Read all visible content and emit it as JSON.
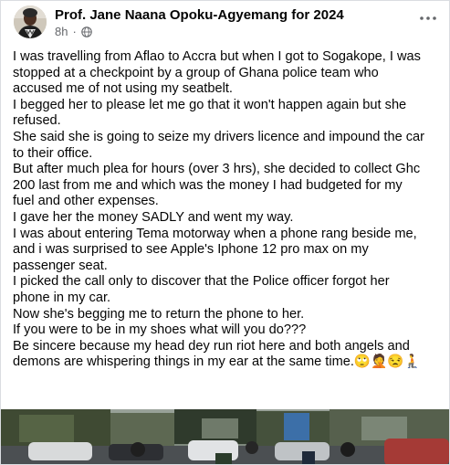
{
  "post": {
    "author": "Prof. Jane Naana Opoku-Agyemang for 2024",
    "time": "8h",
    "separator": "·",
    "privacy_icon": "globe-icon",
    "more_icon": "more-options-icon",
    "lines": [
      "I was travelling from Aflao to Accra but when I got to Sogakope, I was",
      "stopped at a checkpoint by a group of Ghana police team who",
      "accused me of not using my seatbelt.",
      "I begged her to please let me go that it won't happen again but she",
      "refused.",
      "She said she is going to seize my drivers licence and impound the car",
      "to their office.",
      "But after much plea for hours (over 3 hrs), she decided to collect Ghc",
      "200 last from me and which was the money I had budgeted for my",
      "fuel and other expenses.",
      "I gave her the money SADLY and went my way.",
      "I was about entering Tema motorway when a phone rang beside me,",
      "and i was surprised to see Apple's Iphone 12 pro max on my",
      "passenger seat.",
      "I picked the call only to discover that the Police officer forgot her",
      "phone in my car.",
      "Now she's begging me to return the phone to her.",
      "If you were to be in my shoes what will you do???",
      "Be sincere because my head dey run riot here and both angels and",
      "demons are whispering things in my ear at the same time.🙄🤦😒🧎"
    ]
  },
  "colors": {
    "text": "#050505",
    "secondary": "#65676b",
    "border": "#dadde1"
  }
}
